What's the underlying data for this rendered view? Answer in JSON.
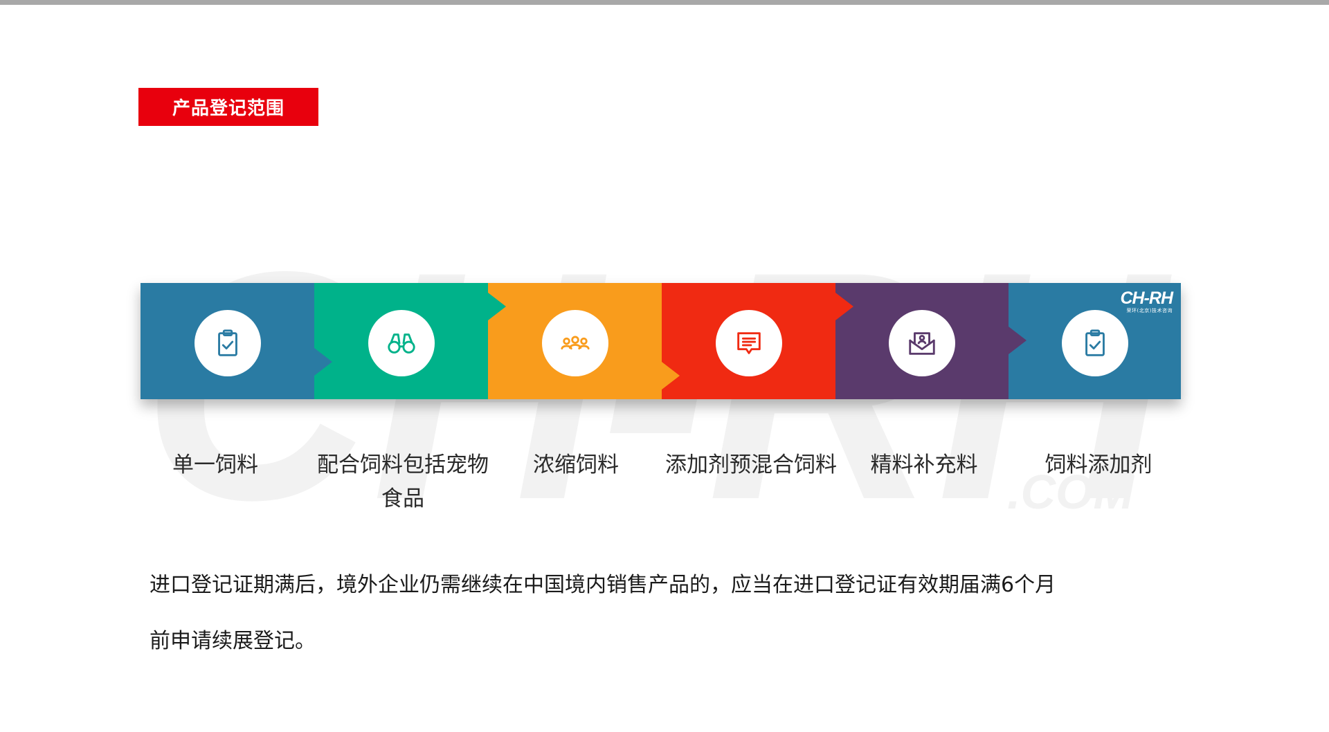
{
  "section_title": "产品登记范围",
  "logo": {
    "mark": "CH-RH",
    "sub": "荣环(北京)技术咨询",
    "watermark": "CH-RH",
    "watermark_suffix": ".COM"
  },
  "colors": {
    "blue": "#2a7ba3",
    "green": "#00b28a",
    "orange": "#f99c1c",
    "red": "#f02a12",
    "purple": "#5a3a6c",
    "accent_red": "#e8000d"
  },
  "categories": [
    {
      "label": "单一饲料",
      "icon": "clipboard-check-icon",
      "color": "#2a7ba3"
    },
    {
      "label": "配合饲料包括宠物食品",
      "icon": "binoculars-icon",
      "color": "#00b28a"
    },
    {
      "label": "浓缩饲料",
      "icon": "people-group-icon",
      "color": "#f99c1c"
    },
    {
      "label": "添加剂预混合饲料",
      "icon": "message-lines-icon",
      "color": "#f02a12"
    },
    {
      "label": "精料补充料",
      "icon": "mail-open-icon",
      "color": "#5a3a6c"
    },
    {
      "label": "饲料添加剂",
      "icon": "clipboard-check-icon",
      "color": "#2a7ba3"
    }
  ],
  "note": {
    "line1": "进口登记证期满后，境外企业仍需继续在中国境内销售产品的，应当在进口登记证有效期届满6个月",
    "line2": "前申请续展登记。"
  }
}
